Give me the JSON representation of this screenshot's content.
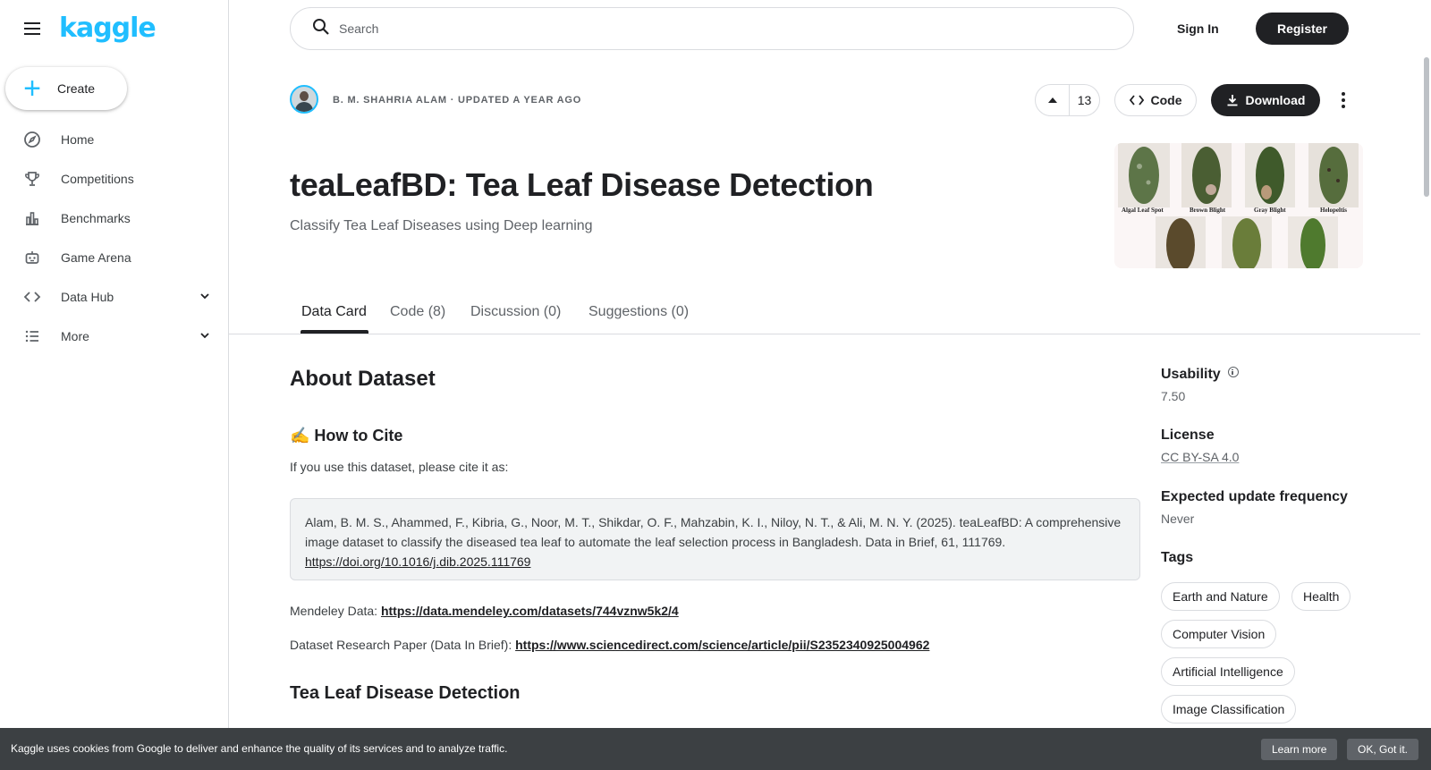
{
  "app": {
    "logo": "kaggle"
  },
  "sidebar": {
    "create_label": "Create",
    "items": [
      {
        "label": "Home",
        "icon": "compass-icon"
      },
      {
        "label": "Competitions",
        "icon": "trophy-icon"
      },
      {
        "label": "Benchmarks",
        "icon": "bar-chart-icon"
      },
      {
        "label": "Game Arena",
        "icon": "robot-icon"
      },
      {
        "label": "Data Hub",
        "icon": "code-brackets-icon"
      },
      {
        "label": "More",
        "icon": "list-icon"
      }
    ]
  },
  "header": {
    "search_placeholder": "Search",
    "sign_in": "Sign In",
    "register": "Register"
  },
  "dataset": {
    "owner_line": "B. M. Shahria Alam · Updated a year ago",
    "vote_count": "13",
    "code_label": "Code",
    "download_label": "Download",
    "title": "teaLeafBD: Tea Leaf Disease Detection",
    "subtitle": "Classify Tea Leaf Diseases using Deep learning",
    "thumbnail_captions": [
      "Algal Leaf Spot",
      "Brown Blight",
      "Gray Blight",
      "Helopeltis"
    ]
  },
  "tabs": [
    {
      "label": "Data Card"
    },
    {
      "label": "Code (8)"
    },
    {
      "label": "Discussion (0)"
    },
    {
      "label": "Suggestions (0)"
    }
  ],
  "content": {
    "about_heading": "About Dataset",
    "cite_heading": "✍️ How to Cite",
    "cite_intro": "If you use this dataset, please cite it as:",
    "citation_text": "Alam, B. M. S., Ahammed, F., Kibria, G., Noor, M. T., Shikdar, O. F., Mahzabin, K. I., Niloy, N. T., & Ali, M. N. Y. (2025). teaLeafBD: A comprehensive image dataset to classify the diseased tea leaf to automate the leaf selection process in Bangladesh. Data in Brief, 61, 111769. ",
    "citation_doi": "https://doi.org/10.1016/j.dib.2025.111769",
    "mendeley_label": "Mendeley Data: ",
    "mendeley_url": "https://data.mendeley.com/datasets/744vznw5k2/4",
    "paper_label": "Dataset Research Paper (Data In Brief): ",
    "paper_url": "https://www.sciencedirect.com/science/article/pii/S2352340925004962",
    "section_heading": "Tea Leaf Disease Detection"
  },
  "meta": {
    "usability_label": "Usability",
    "usability_value": "7.50",
    "license_label": "License",
    "license_value": "CC BY-SA 4.0",
    "update_label": "Expected update frequency",
    "update_value": "Never",
    "tags_label": "Tags",
    "tags": [
      "Earth and Nature",
      "Health",
      "Computer Vision",
      "Artificial Intelligence",
      "Image Classification"
    ]
  },
  "cookie": {
    "message": "Kaggle uses cookies from Google to deliver and enhance the quality of its services and to analyze traffic.",
    "learn_more": "Learn more",
    "ok": "OK, Got it."
  }
}
